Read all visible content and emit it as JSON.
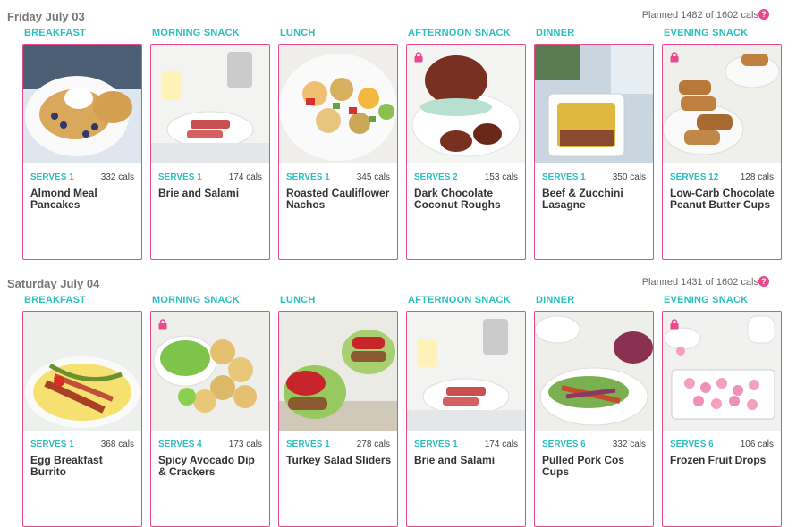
{
  "days": [
    {
      "title": "Friday July 03",
      "planned": "Planned 1482 of 1602 cals",
      "meals": [
        {
          "label": "BREAKFAST",
          "serves": "SERVES 1",
          "cals": "332 cals",
          "name": "Almond Meal Pancakes",
          "locked": false,
          "image": "pancakes"
        },
        {
          "label": "MORNING SNACK",
          "serves": "SERVES 1",
          "cals": "174 cals",
          "name": "Brie and Salami",
          "locked": false,
          "image": "brie"
        },
        {
          "label": "LUNCH",
          "serves": "SERVES 1",
          "cals": "345 cals",
          "name": "Roasted Cauliflower Nachos",
          "locked": false,
          "image": "nachos"
        },
        {
          "label": "AFTERNOON SNACK",
          "serves": "SERVES 2",
          "cals": "153 cals",
          "name": "Dark Chocolate Coconut Roughs",
          "locked": true,
          "image": "roughs"
        },
        {
          "label": "DINNER",
          "serves": "SERVES 1",
          "cals": "350 cals",
          "name": "Beef & Zucchini Lasagne",
          "locked": false,
          "image": "lasagne"
        },
        {
          "label": "EVENING SNACK",
          "serves": "SERVES 12",
          "cals": "128 cals",
          "name": "Low-Carb Chocolate Peanut Butter Cups",
          "locked": true,
          "image": "pbcups"
        }
      ]
    },
    {
      "title": "Saturday July 04",
      "planned": "Planned 1431 of 1602 cals",
      "meals": [
        {
          "label": "BREAKFAST",
          "serves": "SERVES 1",
          "cals": "368 cals",
          "name": "Egg Breakfast Burrito",
          "locked": false,
          "image": "burrito"
        },
        {
          "label": "MORNING SNACK",
          "serves": "SERVES 4",
          "cals": "173 cals",
          "name": "Spicy Avocado Dip & Crackers",
          "locked": true,
          "image": "avocado"
        },
        {
          "label": "LUNCH",
          "serves": "SERVES 1",
          "cals": "278 cals",
          "name": "Turkey Salad Sliders",
          "locked": false,
          "image": "sliders"
        },
        {
          "label": "AFTERNOON SNACK",
          "serves": "SERVES 1",
          "cals": "174 cals",
          "name": "Brie and Salami",
          "locked": false,
          "image": "brie"
        },
        {
          "label": "DINNER",
          "serves": "SERVES 6",
          "cals": "332 cals",
          "name": "Pulled Pork Cos Cups",
          "locked": false,
          "image": "cos"
        },
        {
          "label": "EVENING SNACK",
          "serves": "SERVES 6",
          "cals": "106 cals",
          "name": "Frozen Fruit Drops",
          "locked": true,
          "image": "drops"
        }
      ]
    }
  ],
  "help_icon_glyph": "?",
  "colors": {
    "accent_teal": "#2bbfc0",
    "accent_pink": "#e84a8d"
  }
}
